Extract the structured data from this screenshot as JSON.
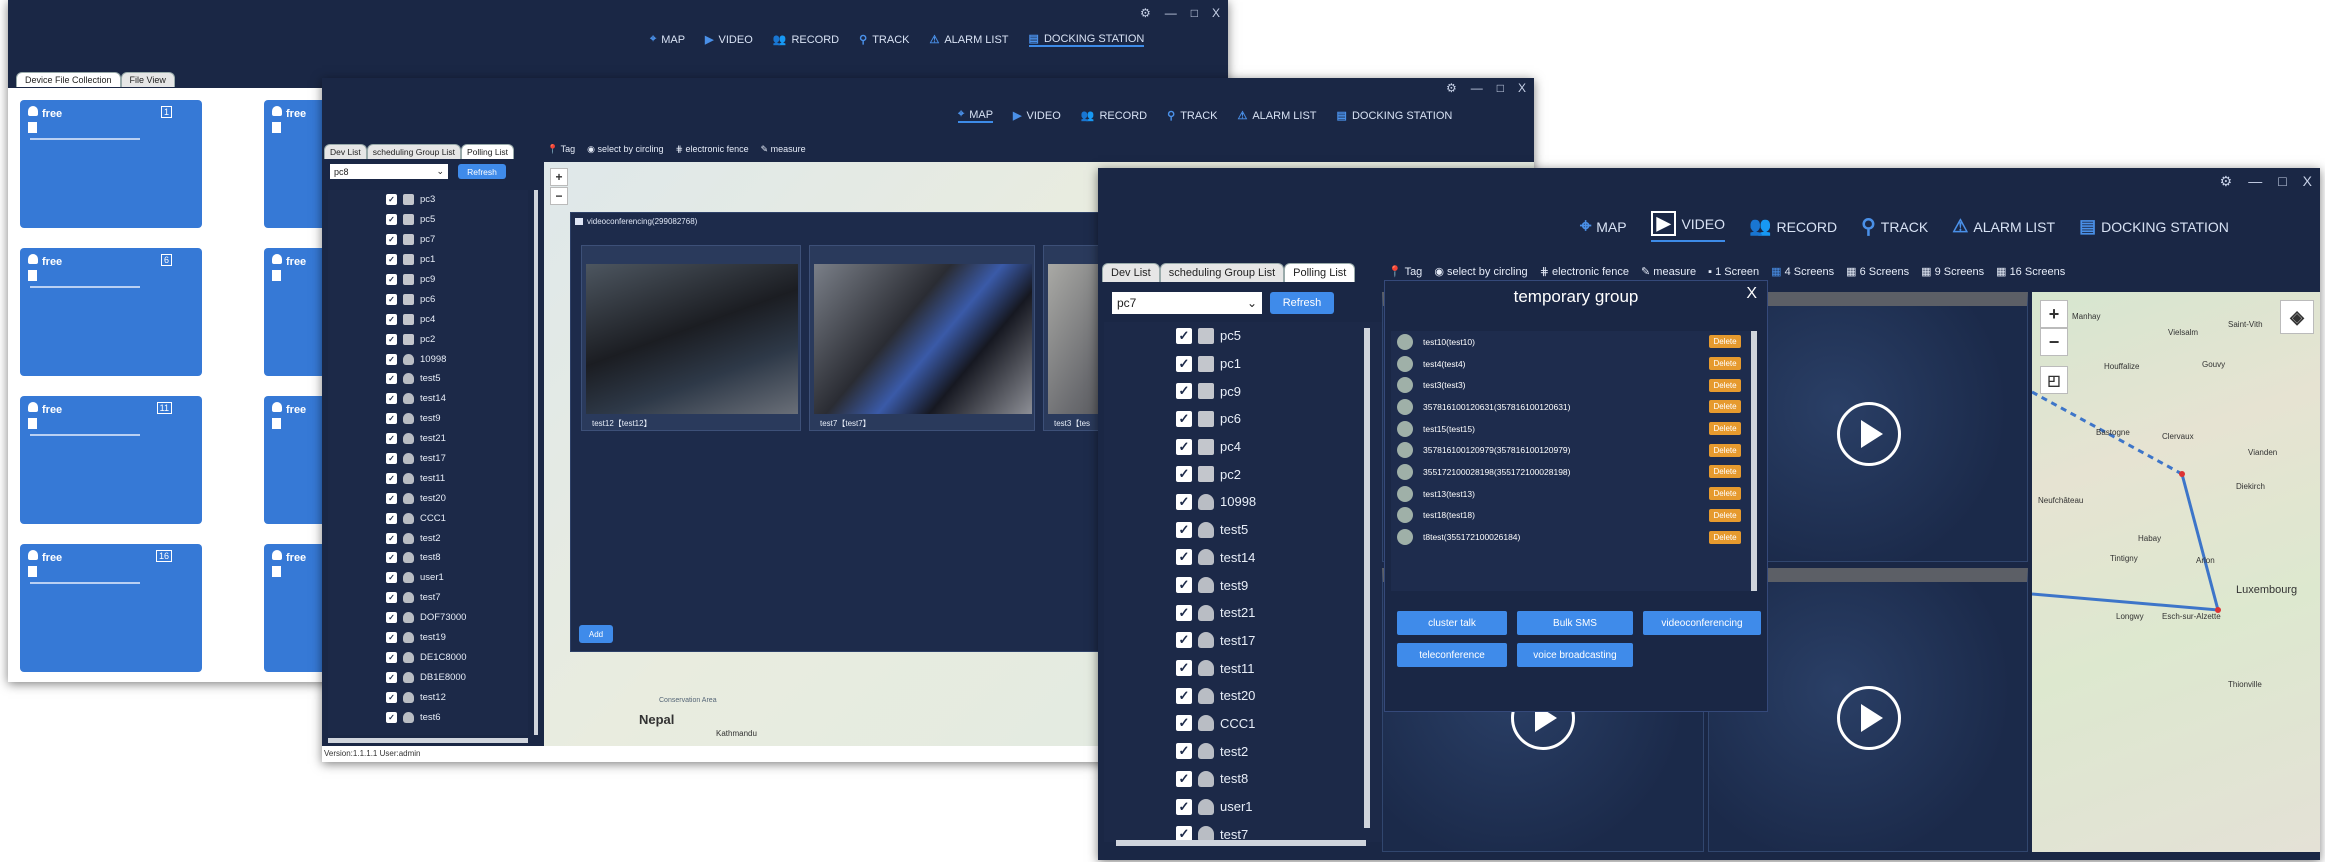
{
  "win1": {
    "nav": [
      {
        "label": "MAP",
        "icon": "map-pin-icon"
      },
      {
        "label": "VIDEO",
        "icon": "play-icon"
      },
      {
        "label": "RECORD",
        "icon": "users-icon"
      },
      {
        "label": "TRACK",
        "icon": "track-icon"
      },
      {
        "label": "ALARM LIST",
        "icon": "alarm-icon"
      },
      {
        "label": "DOCKING STATION",
        "icon": "docking-icon"
      }
    ],
    "controls": {
      "settings": "⚙",
      "minimize": "—",
      "maximize": "□",
      "close": "X"
    },
    "tabs": [
      "Device File Collection",
      "File View"
    ],
    "cards": [
      {
        "name": "free",
        "num": "1"
      },
      {
        "name": "free",
        "num": ""
      },
      {
        "name": "free",
        "num": "6"
      },
      {
        "name": "free",
        "num": ""
      },
      {
        "name": "free",
        "num": "11"
      },
      {
        "name": "free",
        "num": ""
      },
      {
        "name": "free",
        "num": "16"
      },
      {
        "name": "free",
        "num": ""
      }
    ]
  },
  "win2": {
    "nav": [
      {
        "label": "MAP",
        "icon": "map-pin-icon"
      },
      {
        "label": "VIDEO",
        "icon": "play-icon"
      },
      {
        "label": "RECORD",
        "icon": "users-icon"
      },
      {
        "label": "TRACK",
        "icon": "track-icon"
      },
      {
        "label": "ALARM LIST",
        "icon": "alarm-icon"
      },
      {
        "label": "DOCKING STATION",
        "icon": "docking-icon"
      }
    ],
    "controls": {
      "settings": "⚙",
      "minimize": "—",
      "maximize": "□",
      "close": "X"
    },
    "tabs": [
      "Dev List",
      "scheduling Group List",
      "Polling List"
    ],
    "select_value": "pc8",
    "refresh": "Refresh",
    "tools": [
      "Tag",
      "select by circling",
      "electronic fence",
      "measure"
    ],
    "tree": [
      "pc3",
      "pc5",
      "pc7",
      "pc1",
      "pc9",
      "pc6",
      "pc4",
      "pc2",
      "10998",
      "test5",
      "test14",
      "test9",
      "test21",
      "test17",
      "test11",
      "test20",
      "CCC1",
      "test2",
      "test8",
      "user1",
      "test7",
      "DOF73000",
      "test19",
      "DE1C8000",
      "DB1E8000",
      "test12",
      "test6"
    ],
    "tree_types": [
      "pc",
      "pc",
      "pc",
      "pc",
      "pc",
      "pc",
      "pc",
      "pc",
      "user",
      "user",
      "user",
      "user",
      "user",
      "user",
      "user",
      "user",
      "user",
      "user",
      "user",
      "user",
      "user",
      "user",
      "user",
      "user",
      "user",
      "user",
      "user"
    ],
    "vc_title": "videoconferencing(299082768)",
    "vc_labels": [
      "test12【test12】",
      "test7【test7】",
      "test3【tes"
    ],
    "add": "Add",
    "map_labels": {
      "nepal": "Nepal",
      "kathmandu": "Kathmandu",
      "conservation": "Conservation Area"
    },
    "zoom_in": "+",
    "zoom_out": "−",
    "status": "Version:1.1.1.1  User:admin"
  },
  "win3": {
    "nav": [
      {
        "label": "MAP",
        "icon": "map-pin-icon"
      },
      {
        "label": "VIDEO",
        "icon": "play-icon"
      },
      {
        "label": "RECORD",
        "icon": "users-icon"
      },
      {
        "label": "TRACK",
        "icon": "track-icon"
      },
      {
        "label": "ALARM LIST",
        "icon": "alarm-icon"
      },
      {
        "label": "DOCKING STATION",
        "icon": "docking-icon"
      }
    ],
    "controls": {
      "settings": "⚙",
      "minimize": "—",
      "maximize": "□",
      "close": "X"
    },
    "tabs": [
      "Dev List",
      "scheduling Group List",
      "Polling List"
    ],
    "select_value": "pc7",
    "refresh": "Refresh",
    "tools": [
      "Tag",
      "select by circling",
      "electronic fence",
      "measure",
      "1 Screen",
      "4 Screens",
      "6 Screens",
      "9 Screens",
      "16 Screens"
    ],
    "tree": [
      "pc5",
      "pc1",
      "pc9",
      "pc6",
      "pc4",
      "pc2",
      "10998",
      "test5",
      "test14",
      "test9",
      "test21",
      "test17",
      "test11",
      "test20",
      "CCC1",
      "test2",
      "test8",
      "user1",
      "test7"
    ],
    "tree_types": [
      "pc",
      "pc",
      "pc",
      "pc",
      "pc",
      "pc",
      "user",
      "user",
      "user",
      "user",
      "user",
      "user",
      "user",
      "user",
      "user",
      "user",
      "user",
      "user",
      "user"
    ],
    "group": {
      "title": "temporary group",
      "close": "X",
      "members": [
        "test10(test10)",
        "test4(test4)",
        "test3(test3)",
        "357816100120631(357816100120631)",
        "test15(test15)",
        "357816100120979(357816100120979)",
        "355172100028198(355172100028198)",
        "test13(test13)",
        "test18(test18)",
        "t8test(355172100026184)"
      ],
      "delete_label": "Delete",
      "buttons": [
        "cluster talk",
        "Bulk SMS",
        "videoconferencing",
        "teleconference",
        "voice broadcasting"
      ]
    },
    "map_labels": [
      "Manhay",
      "Vielsalm",
      "Saint-Vith",
      "Gouvy",
      "Houffalize",
      "Clervaux",
      "Bastogne",
      "Vianden",
      "Diekirch",
      "Habay",
      "Arlon",
      "Tintigny",
      "Luxembourg",
      "Longwy",
      "Esch-sur-Alzette",
      "Thionville",
      "Neufchâteau"
    ],
    "zoom_in": "+",
    "zoom_out": "−"
  },
  "colors": {
    "window_bg": "#1a2745",
    "accent": "#3f8bea",
    "card": "#3679d6",
    "delete": "#e69a2e"
  }
}
